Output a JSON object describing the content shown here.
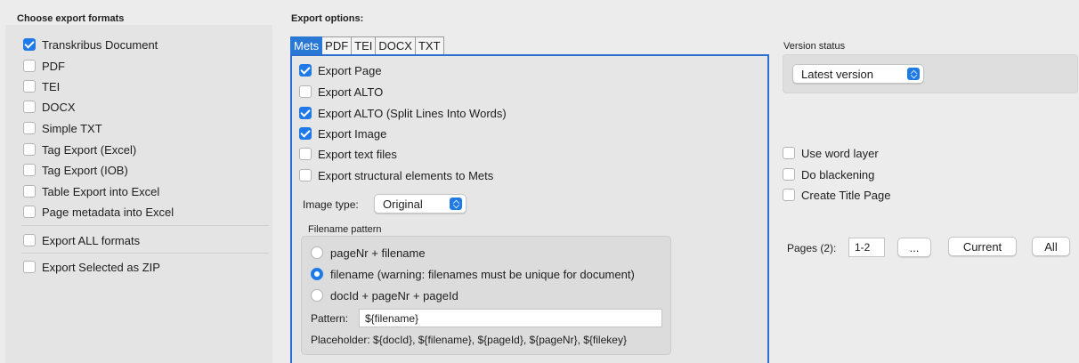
{
  "left": {
    "header": "Choose export formats",
    "formats": [
      {
        "label": "Transkribus Document",
        "checked": true
      },
      {
        "label": "PDF",
        "checked": false
      },
      {
        "label": "TEI",
        "checked": false
      },
      {
        "label": "DOCX",
        "checked": false
      },
      {
        "label": "Simple TXT",
        "checked": false
      },
      {
        "label": "Tag Export (Excel)",
        "checked": false
      },
      {
        "label": "Tag Export (IOB)",
        "checked": false
      },
      {
        "label": "Table Export into Excel",
        "checked": false
      },
      {
        "label": "Page metadata into Excel",
        "checked": false
      }
    ],
    "export_all": {
      "label": "Export ALL formats",
      "checked": false
    },
    "export_zip": {
      "label": "Export Selected as ZIP",
      "checked": false
    }
  },
  "options": {
    "header": "Export options:",
    "tabs": [
      "Mets",
      "PDF",
      "TEI",
      "DOCX",
      "TXT"
    ],
    "active_tab": "Mets",
    "mets": {
      "checks": [
        {
          "label": "Export Page",
          "checked": true
        },
        {
          "label": "Export ALTO",
          "checked": false
        },
        {
          "label": "Export ALTO (Split Lines Into Words)",
          "checked": true
        },
        {
          "label": "Export Image",
          "checked": true
        },
        {
          "label": "Export text files",
          "checked": false
        },
        {
          "label": "Export structural elements to Mets",
          "checked": false
        }
      ],
      "image_type_label": "Image type:",
      "image_type_value": "Original",
      "filename": {
        "title": "Filename pattern",
        "radios": [
          {
            "label": "pageNr + filename",
            "selected": false
          },
          {
            "label": "filename (warning: filenames must be unique for document)",
            "selected": true
          },
          {
            "label": "docId + pageNr + pageId",
            "selected": false
          }
        ],
        "pattern_label": "Pattern:",
        "pattern_value": "${filename}",
        "placeholder_text": "Placeholder: ${docId}, ${filename}, ${pageId}, ${pageNr}, ${filekey}"
      }
    }
  },
  "right": {
    "version_label": "Version status",
    "version_value": "Latest version",
    "checks": [
      {
        "label": "Use word layer",
        "checked": false
      },
      {
        "label": "Do blackening",
        "checked": false
      },
      {
        "label": "Create Title Page",
        "checked": false
      }
    ],
    "pages_label": "Pages (2):",
    "pages_value": "1-2",
    "ellipsis_button": "...",
    "current_button": "Current",
    "all_button": "All"
  },
  "colors": {
    "accent": "#1f7ae8",
    "tab_active": "#2a78d6",
    "panel_border": "#2a6fd1"
  }
}
